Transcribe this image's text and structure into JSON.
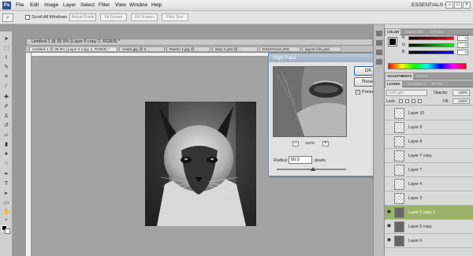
{
  "app": {
    "logo": "Ps",
    "workspace": "ESSENTIALS ▾"
  },
  "menu": [
    "File",
    "Edit",
    "Image",
    "Layer",
    "Select",
    "Filter",
    "View",
    "Window",
    "Help"
  ],
  "window_controls": [
    "–",
    "□",
    "×"
  ],
  "options_bar": {
    "scroll_all_windows": "Scroll All Windows",
    "buttons": [
      "Actual Pixels",
      "Fit Screen",
      "Fill Screen",
      "Print Size"
    ]
  },
  "document": {
    "title": "Untitled-1 @ 35.9% (Layer 0 copy 2, RGB/8) *",
    "tabs": [
      "Untitled-1 @ 35.9% (Layer 0 copy 2, RGB/8) *",
      "Aestn.jpg @ 3...",
      "Resrin 1.jpg @ ...",
      "step 2.psd @ ...",
      "DSCF0124.JPG",
      "layers info.psd"
    ]
  },
  "dialog": {
    "title": "High Pass",
    "ok": "OK",
    "reset": "Reset",
    "preview_label": "Preview",
    "preview_checked": "✓",
    "zoom_out": "–",
    "zoom_in": "+",
    "zoom": "100%",
    "radius_label": "Radius:",
    "radius_value": "50.0",
    "radius_unit": "pixels",
    "slider_level": 0.52
  },
  "color_panel": {
    "tabs": [
      "COLOR",
      "SWATCHES",
      "STYLES"
    ],
    "rows": [
      {
        "label": "R",
        "value": "0",
        "gradient": "linear-gradient(90deg,#000,#f00)"
      },
      {
        "label": "G",
        "value": "0",
        "gradient": "linear-gradient(90deg,#000,#0f0)"
      },
      {
        "label": "B",
        "value": "0",
        "gradient": "linear-gradient(90deg,#000,#00f)"
      }
    ]
  },
  "adjustments_tabs": [
    "ADJUSTMENTS",
    "MASKS"
  ],
  "layers_panel": {
    "tabs": [
      "LAYERS",
      "CHANNELS",
      "PATHS"
    ],
    "blend_mode": "Soft Light",
    "opacity_label": "Opacity:",
    "opacity_value": "100%",
    "lock_label": "Lock:",
    "fill_label": "Fill:",
    "fill_value": "100%",
    "eye_glyph": "◉",
    "layers": [
      {
        "name": "Layer 10",
        "visible": false,
        "active": false,
        "photo": false
      },
      {
        "name": "Layer 9",
        "visible": false,
        "active": false,
        "photo": false
      },
      {
        "name": "Layer 8",
        "visible": false,
        "active": false,
        "photo": false
      },
      {
        "name": "Layer 7 copy",
        "visible": false,
        "active": false,
        "photo": false
      },
      {
        "name": "Layer 7",
        "visible": false,
        "active": false,
        "photo": false
      },
      {
        "name": "Layer 4",
        "visible": false,
        "active": false,
        "photo": false
      },
      {
        "name": "Layer 2",
        "visible": false,
        "active": false,
        "photo": false
      },
      {
        "name": "Layer 0 copy 2",
        "visible": true,
        "active": true,
        "photo": true
      },
      {
        "name": "Layer 0 copy",
        "visible": true,
        "active": false,
        "photo": true
      },
      {
        "name": "Layer 0",
        "visible": true,
        "active": false,
        "photo": true
      }
    ]
  },
  "colors": {
    "accent_active_layer": "#9db269",
    "dialog_titlebar": "#9fb1c7",
    "close_button": "#cf4d3a"
  }
}
